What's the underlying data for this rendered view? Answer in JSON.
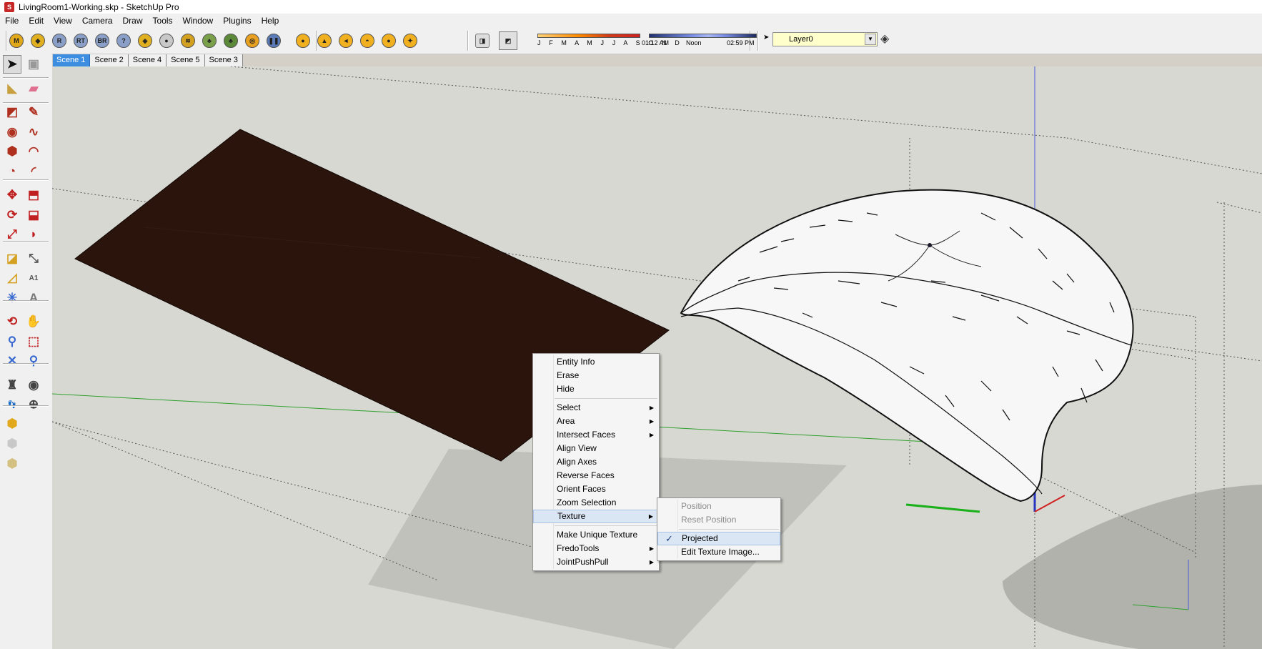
{
  "window": {
    "title": "LivingRoom1-Working.skp - SketchUp Pro"
  },
  "menubar": {
    "items": [
      "File",
      "Edit",
      "View",
      "Camera",
      "Draw",
      "Tools",
      "Window",
      "Plugins",
      "Help"
    ]
  },
  "toolbar": {
    "buttons": [
      {
        "name": "m-plugin-icon",
        "glyph": "M",
        "color": "#e0a81a"
      },
      {
        "name": "gem-icon",
        "glyph": "◆",
        "color": "#e0b020"
      },
      {
        "name": "r-render-icon",
        "glyph": "R",
        "color": "#8aa0c8"
      },
      {
        "name": "rt-render-icon",
        "glyph": "RT",
        "color": "#8aa0c8"
      },
      {
        "name": "br-render-icon",
        "glyph": "BR",
        "color": "#8aa0c8"
      },
      {
        "name": "help-icon",
        "glyph": "?",
        "color": "#8aa0c8"
      },
      {
        "name": "tag-icon",
        "glyph": "◈",
        "color": "#e0b020"
      },
      {
        "name": "sphere-icon",
        "glyph": "●",
        "color": "#c8c8c8"
      },
      {
        "name": "fence-icon",
        "glyph": "≋",
        "color": "#d4a020"
      },
      {
        "name": "tree-icon",
        "glyph": "♣",
        "color": "#7aa04a"
      },
      {
        "name": "forest-icon",
        "glyph": "♣",
        "color": "#5d8a38"
      },
      {
        "name": "target-icon",
        "glyph": "◎",
        "color": "#e8a020"
      },
      {
        "name": "pause-icon",
        "glyph": "❚❚",
        "color": "#5a7ab8"
      },
      {
        "name": "sun-sphere-icon",
        "glyph": "●",
        "color": "#f0b020"
      },
      {
        "name": "light-icon",
        "glyph": "▲",
        "color": "#f0b020"
      },
      {
        "name": "spotlight-icon",
        "glyph": "◄",
        "color": "#f0b020"
      },
      {
        "name": "dome-icon",
        "glyph": "◓",
        "color": "#f0b020"
      },
      {
        "name": "globe-light-icon",
        "glyph": "●",
        "color": "#f0b020"
      },
      {
        "name": "point-light-icon",
        "glyph": "✦",
        "color": "#f0b020"
      }
    ],
    "shadow": {
      "months": "J F M A M J J A S O N D",
      "time_start": "01:12 AM",
      "time_noon": "Noon",
      "time_end": "02:59 PM"
    },
    "layer": {
      "name": "Layer0"
    }
  },
  "scenes": {
    "tabs": [
      "Scene 1",
      "Scene 2",
      "Scene 4",
      "Scene 5",
      "Scene 3"
    ],
    "active_index": 0
  },
  "left_tools": [
    {
      "name": "select-tool-icon",
      "glyph": "➤",
      "color": "#111"
    },
    {
      "name": "make-component-icon",
      "glyph": "▣",
      "color": "#999"
    },
    {
      "name": "paint-bucket-icon",
      "glyph": "◣",
      "color": "#c8a040"
    },
    {
      "name": "eraser-icon",
      "glyph": "▰",
      "color": "#e07090"
    },
    {
      "name": "rectangle-tool-icon",
      "glyph": "◩",
      "color": "#b03020"
    },
    {
      "name": "line-tool-icon",
      "glyph": "✎",
      "color": "#b03020"
    },
    {
      "name": "circle-tool-icon",
      "glyph": "◉",
      "color": "#b03020"
    },
    {
      "name": "freehand-tool-icon",
      "glyph": "∿",
      "color": "#b03020"
    },
    {
      "name": "polygon-tool-icon",
      "glyph": "⬢",
      "color": "#b03020"
    },
    {
      "name": "arc-tool-icon",
      "glyph": "◠",
      "color": "#b03020"
    },
    {
      "name": "pie-tool-icon",
      "glyph": "◔",
      "color": "#b03020"
    },
    {
      "name": "arc-2-tool-icon",
      "glyph": "◜",
      "color": "#b03020"
    },
    {
      "name": "move-tool-icon",
      "glyph": "✥",
      "color": "#c02020"
    },
    {
      "name": "push-pull-icon",
      "glyph": "⬒",
      "color": "#c02020"
    },
    {
      "name": "rotate-tool-icon",
      "glyph": "⟳",
      "color": "#c02020"
    },
    {
      "name": "follow-me-icon",
      "glyph": "⬓",
      "color": "#c02020"
    },
    {
      "name": "scale-tool-icon",
      "glyph": "⤢",
      "color": "#c02020"
    },
    {
      "name": "offset-tool-icon",
      "glyph": "◗",
      "color": "#c02020"
    },
    {
      "name": "tape-measure-icon",
      "glyph": "◪",
      "color": "#d4a020"
    },
    {
      "name": "dimension-tool-icon",
      "glyph": "⤡",
      "color": "#555"
    },
    {
      "name": "protractor-icon",
      "glyph": "◿",
      "color": "#d4a020"
    },
    {
      "name": "text-tool-icon",
      "glyph": "A1",
      "color": "#555"
    },
    {
      "name": "axes-tool-icon",
      "glyph": "✳",
      "color": "#3a6ad0"
    },
    {
      "name": "3d-text-icon",
      "glyph": "A",
      "color": "#777"
    },
    {
      "name": "orbit-tool-icon",
      "glyph": "⟲",
      "color": "#c02020"
    },
    {
      "name": "pan-tool-icon",
      "glyph": "✋",
      "color": "#777"
    },
    {
      "name": "zoom-tool-icon",
      "glyph": "⚲",
      "color": "#3a6ad0"
    },
    {
      "name": "zoom-window-icon",
      "glyph": "⬚",
      "color": "#c02020"
    },
    {
      "name": "zoom-extents-icon",
      "glyph": "✕",
      "color": "#3a6ad0"
    },
    {
      "name": "previous-view-icon",
      "glyph": "⚲",
      "color": "#3a6ad0"
    },
    {
      "name": "position-camera-icon",
      "glyph": "♜",
      "color": "#444"
    },
    {
      "name": "look-around-icon",
      "glyph": "◉",
      "color": "#444"
    },
    {
      "name": "walk-tool-icon",
      "glyph": "👣",
      "color": "#555"
    },
    {
      "name": "section-plane-icon",
      "glyph": "⊕",
      "color": "#444"
    },
    {
      "name": "warehouse-icon",
      "glyph": "⬢",
      "color": "#e0a81a"
    },
    {
      "name": "share-model-icon",
      "glyph": "⬢",
      "color": "#c8c8c8"
    },
    {
      "name": "get-models-icon",
      "glyph": "⬢",
      "color": "#d4c080"
    }
  ],
  "context_menu": {
    "items": [
      {
        "label": "Entity Info",
        "submenu": false
      },
      {
        "label": "Erase",
        "submenu": false
      },
      {
        "label": "Hide",
        "submenu": false
      },
      {
        "separator": true
      },
      {
        "label": "Select",
        "submenu": true
      },
      {
        "label": "Area",
        "submenu": true
      },
      {
        "label": "Intersect Faces",
        "submenu": true
      },
      {
        "label": "Align View",
        "submenu": false
      },
      {
        "label": "Align Axes",
        "submenu": false
      },
      {
        "label": "Reverse Faces",
        "submenu": false
      },
      {
        "label": "Orient Faces",
        "submenu": false
      },
      {
        "label": "Zoom Selection",
        "submenu": false
      },
      {
        "label": "Texture",
        "submenu": true,
        "highlight": true
      },
      {
        "separator": true
      },
      {
        "label": "Make Unique Texture",
        "submenu": false
      },
      {
        "label": "FredoTools",
        "submenu": true
      },
      {
        "label": "JointPushPull",
        "submenu": true
      }
    ]
  },
  "texture_submenu": {
    "items": [
      {
        "label": "Position",
        "disabled": true
      },
      {
        "label": "Reset Position",
        "disabled": true
      },
      {
        "separator": true
      },
      {
        "label": "Projected",
        "checked": true,
        "highlight": true
      },
      {
        "label": "Edit Texture Image..."
      }
    ]
  }
}
